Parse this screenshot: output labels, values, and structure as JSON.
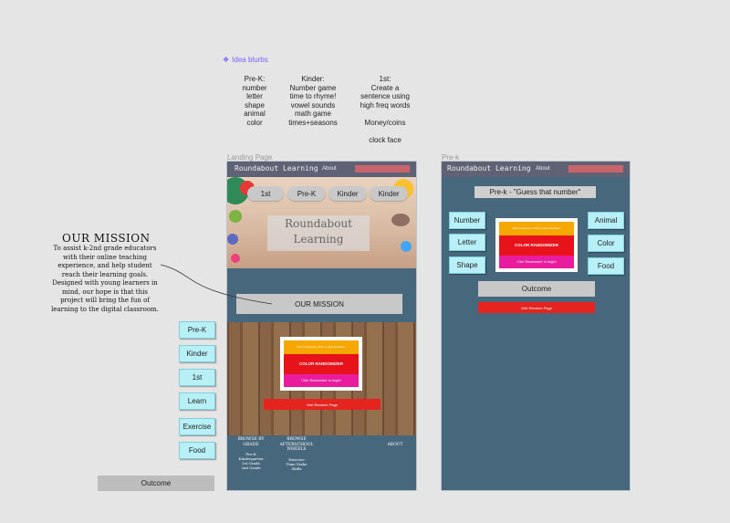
{
  "idea_blurbs": {
    "title": "Idea blurbs",
    "prek": "Pre-K:\nnumber\nletter\nshape\nanimal\ncolor",
    "kinder": "Kinder:\nNumber game\ntime to rhyme!\nvowel sounds\nmath game\ntimes+seasons",
    "first": "1st:\nCreate a\nsentence using\nhigh freq words\n\nMoney/coins\n\nclock face"
  },
  "landing": {
    "label": "Landing Page",
    "nav_title": "Roundabout Learning",
    "nav_about": "About",
    "pills": [
      "1st",
      "Pre-K",
      "Kinder",
      "Kinder"
    ],
    "hero_title": "Roundabout\nLearning",
    "mission_button": "OUR MISSION",
    "randomizer": {
      "top": "Pick a sentence / Pick a color and listen",
      "middle": "COLOR RANDOMIZER",
      "bottom": "Click 'Randomizer' to begin!"
    },
    "visit_button": "Visit Random Page",
    "footer": {
      "col1_head": "BROWSE BY\nGRADE",
      "col1_items": "Pre-K\nKindergarten\n1st Grade\n2nd Grade",
      "col2_head": "BROWSE\nAFTERSCHOOL\nWHEELS",
      "col2_items": "Exercise\nTime Stake\nSkills",
      "col3_head": "ABOUT"
    }
  },
  "mission": {
    "heading": "OUR MISSION",
    "body": "To assist k-2nd grade educators with their online teaching experience, and help student reach their learning goals. Designed with young learners in mind, our hope is that this project will bring the fun of learning to the digital classroom."
  },
  "side_buttons": [
    "Pre-K",
    "Kinder",
    "1st",
    "Learn",
    "Exercise",
    "Food"
  ],
  "outcome_left": "Outcome",
  "prek_page": {
    "label": "Pre-k",
    "nav_title": "Roundabout Learning",
    "nav_about": "About",
    "title": "Pre-k - \"Guess that number\"",
    "left_buttons": [
      "Number",
      "Letter",
      "Shape"
    ],
    "right_buttons": [
      "Animal",
      "Color",
      "Food"
    ],
    "randomizer": {
      "top": "Pick a sentence / Pick a color and listen",
      "middle": "COLOR RANDOMIZER",
      "bottom": "Click 'Randomizer' to begin!"
    },
    "outcome": "Outcome",
    "visit_button": "Visit Random Page"
  },
  "colors": {
    "frame_bg": "#47687c",
    "nav_bg": "#5f6274",
    "accent_button": "#b8f0f8",
    "visit_red": "#e52420",
    "idea_purple": "#7b61ff"
  }
}
